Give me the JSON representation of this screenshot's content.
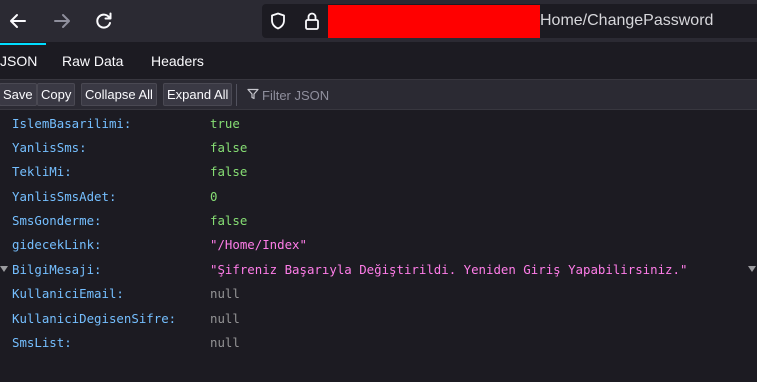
{
  "browser": {
    "back_icon": "arrow-left-icon",
    "forward_icon": "arrow-right-icon",
    "reload_icon": "reload-icon",
    "url_path": "Home/ChangePassword"
  },
  "tabs": [
    {
      "label": "JSON",
      "active": true
    },
    {
      "label": "Raw Data",
      "active": false
    },
    {
      "label": "Headers",
      "active": false
    }
  ],
  "toolbar": {
    "save_label": "Save",
    "copy_label": "Copy",
    "collapse_label": "Collapse All",
    "expand_label": "Expand All",
    "filter_placeholder": "Filter JSON"
  },
  "json_rows": [
    {
      "key": "IslemBasarilimi:",
      "value": "true",
      "type": "bool"
    },
    {
      "key": "YanlisSms:",
      "value": "false",
      "type": "bool"
    },
    {
      "key": "TekliMi:",
      "value": "false",
      "type": "bool"
    },
    {
      "key": "YanlisSmsAdet:",
      "value": "0",
      "type": "num"
    },
    {
      "key": "SmsGonderme:",
      "value": "false",
      "type": "bool"
    },
    {
      "key": "gidecekLink:",
      "value": "\"/Home/Index\"",
      "type": "str"
    },
    {
      "key": "BilgiMesaji:",
      "value": "\"Şifreniz Başarıyla Değiştirildi. Yeniden Giriş Yapabilirsiniz.\"",
      "type": "str",
      "expandable": true
    },
    {
      "key": "KullaniciEmail:",
      "value": "null",
      "type": "null"
    },
    {
      "key": "KullaniciDegisenSifre:",
      "value": "null",
      "type": "null"
    },
    {
      "key": "SmsList:",
      "value": "null",
      "type": "null"
    }
  ],
  "colors": {
    "key": "#75bfff",
    "bool": "#86de74",
    "string": "#ff7de9",
    "null": "#939395",
    "redaction": "#ff0000"
  }
}
